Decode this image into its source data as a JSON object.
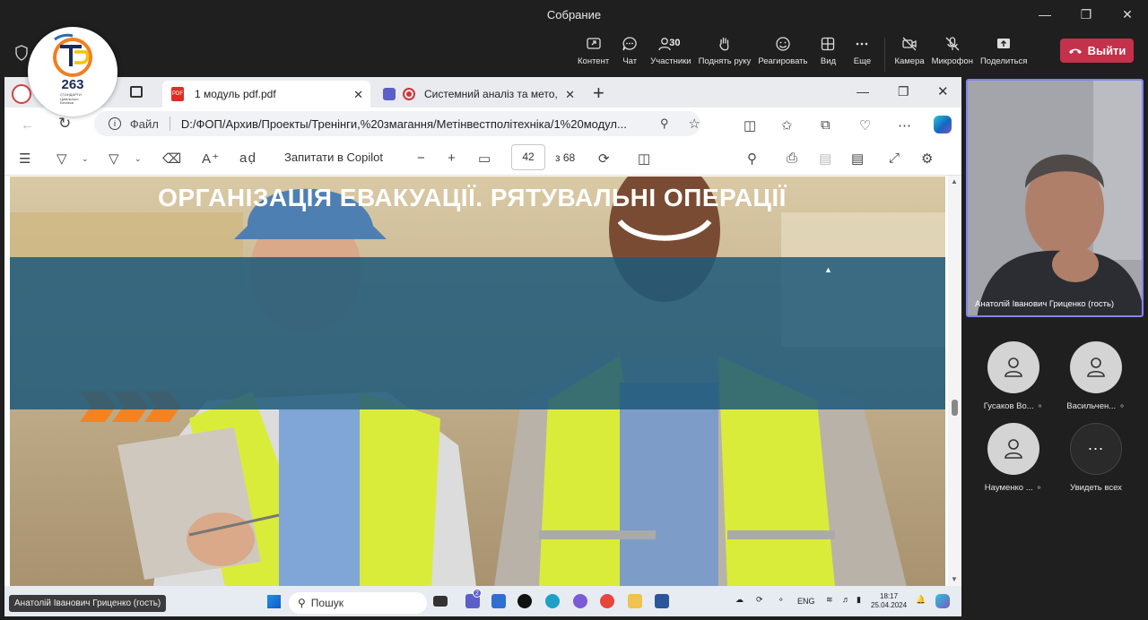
{
  "window": {
    "title": "Собрание"
  },
  "toolbar": {
    "items": [
      {
        "label": "Контент",
        "icon": "share-screen-icon"
      },
      {
        "label": "Чат",
        "icon": "chat-icon"
      },
      {
        "label": "Участники",
        "icon": "participants-icon",
        "count": "30"
      },
      {
        "label": "Поднять руку",
        "icon": "raise-hand-icon"
      },
      {
        "label": "Реагировать",
        "icon": "react-icon"
      },
      {
        "label": "Вид",
        "icon": "view-icon"
      },
      {
        "label": "Еще",
        "icon": "more-icon"
      }
    ],
    "devices": [
      {
        "label": "Камера",
        "icon": "camera-off-icon"
      },
      {
        "label": "Микрофон",
        "icon": "mic-off-icon"
      },
      {
        "label": "Поделиться",
        "icon": "share-icon"
      }
    ],
    "exit_label": "Выйти",
    "exit_color": "#c4314b"
  },
  "logo": {
    "number": "263",
    "caption": "СТАНДАРТИ Цивільного Безпеки"
  },
  "browser": {
    "tabs": [
      {
        "label": "1 модуль pdf.pdf"
      },
      {
        "label": "Системний аналіз та мето,"
      }
    ],
    "url_prefix": "Файл",
    "url": "D:/ФОП/Архив/Проекты/Тренінги,%20змагання/Метінвестполітехніка/1%20модул...",
    "pdf": {
      "ask_copilot": "Запитати в Copilot",
      "page": "42",
      "total": "з 68"
    }
  },
  "slide": {
    "title": "ОРГАНІЗАЦІЯ ЕВАКУАЦІЇ. РЯТУВАЛЬНІ ОПЕРАЦІЇ"
  },
  "taskbar": {
    "search": "Пошук",
    "lang": "ENG",
    "time": "18:17",
    "date": "25.04.2024",
    "teams_badge": "2"
  },
  "presenter_tag": "Анатолій Іванович Гриценко (гость)",
  "video": {
    "caption": "Анатолій Іванович Гриценко (гость)"
  },
  "participants": [
    {
      "name": "Гусаков Во..."
    },
    {
      "name": "Васильчен..."
    },
    {
      "name": "Науменко ..."
    }
  ],
  "see_all": "Увидеть всех"
}
